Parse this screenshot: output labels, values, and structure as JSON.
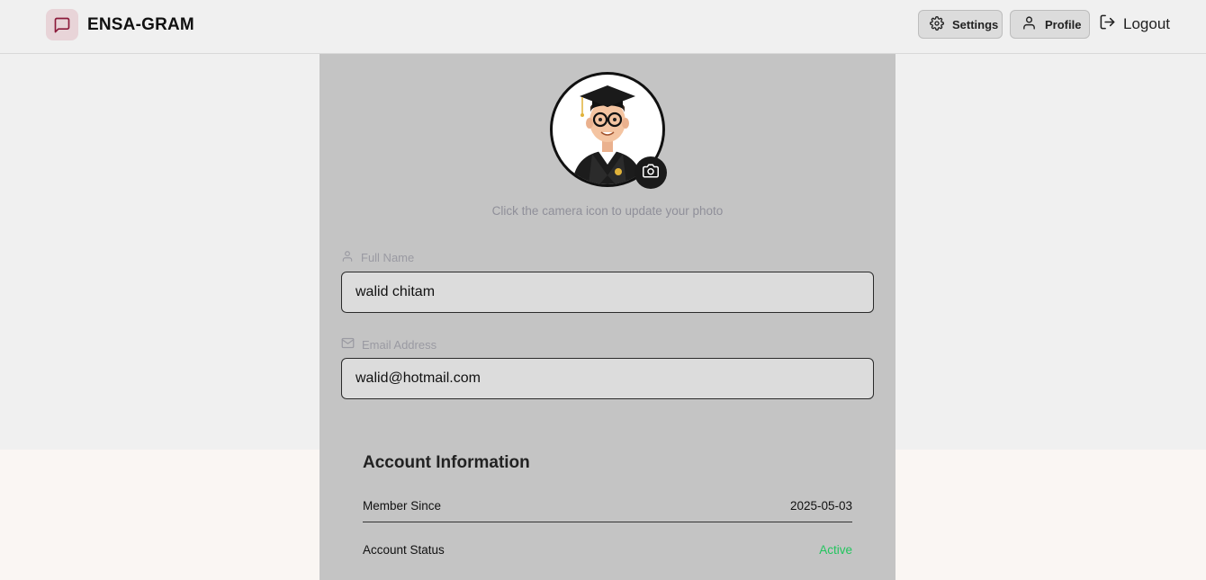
{
  "brand": {
    "name": "ENSA-GRAM",
    "logo_icon": "message-square-icon",
    "accent": "#8b1a3a"
  },
  "nav": {
    "settings_label": "Settings",
    "profile_label": "Profile",
    "logout_label": "Logout"
  },
  "profile": {
    "photo_hint": "Click the camera icon to update your photo",
    "full_name_label": "Full Name",
    "full_name_value": "walid chitam",
    "email_label": "Email Address",
    "email_value": "walid@hotmail.com"
  },
  "account": {
    "title": "Account Information",
    "member_since_label": "Member Since",
    "member_since_value": "2025-05-03",
    "status_label": "Account Status",
    "status_value": "Active",
    "status_color": "#22c55e"
  }
}
